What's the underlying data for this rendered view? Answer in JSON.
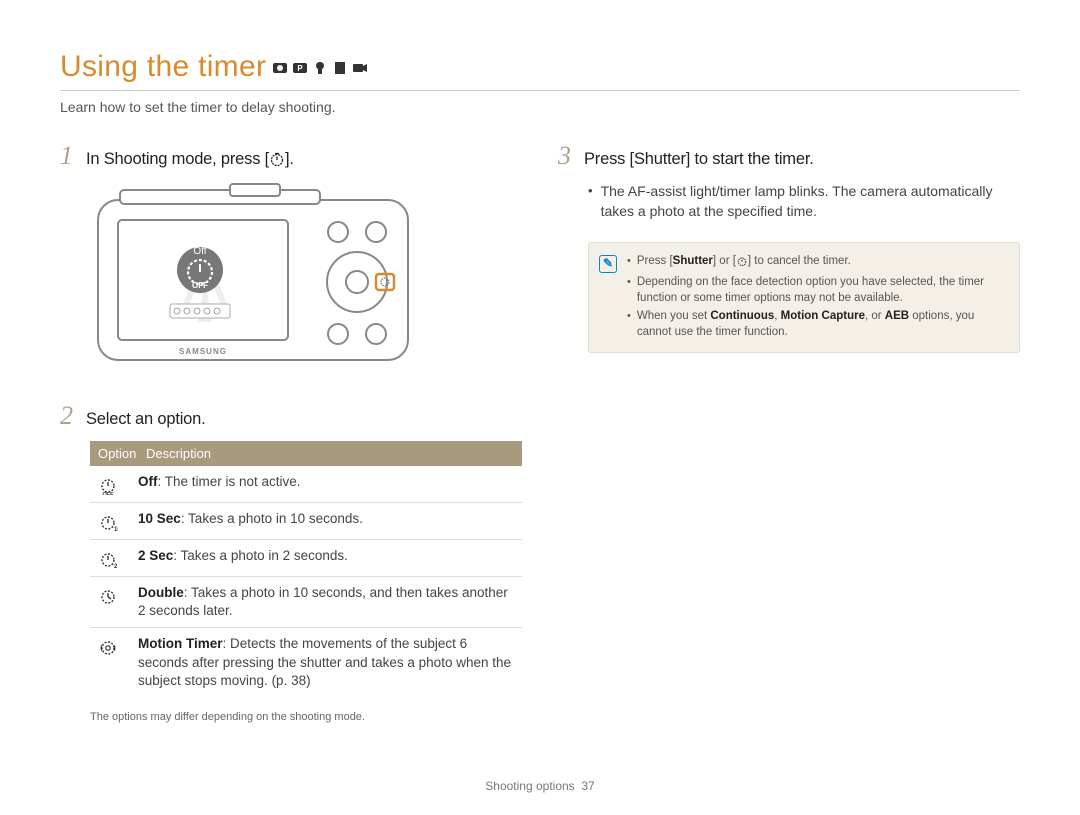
{
  "title": "Using the timer",
  "subtitle": "Learn how to set the timer to delay shooting.",
  "steps": {
    "s1": {
      "num": "1",
      "text": "In Shooting mode, press [",
      "text_after": "]."
    },
    "s2": {
      "num": "2",
      "text": "Select an option."
    },
    "s3": {
      "num": "3",
      "text": "Press [Shutter] to start the timer."
    }
  },
  "right_bullet": "The AF-assist light/timer lamp blinks. The camera automatically takes a photo at the specified time.",
  "table": {
    "head_option": "Option",
    "head_desc": "Description",
    "rows": [
      {
        "bold": "Off",
        "rest": ": The timer is not active."
      },
      {
        "bold": "10 Sec",
        "rest": ": Takes a photo in 10 seconds."
      },
      {
        "bold": "2 Sec",
        "rest": ": Takes a photo in 2 seconds."
      },
      {
        "bold": "Double",
        "rest": ": Takes a photo in 10 seconds, and then takes another 2 seconds later."
      },
      {
        "bold": "Motion Timer",
        "rest": ": Detects the movements of the subject 6 seconds after pressing the shutter and takes a photo when the subject stops moving. (p. 38)"
      }
    ],
    "footnote": "The options may differ depending on the shooting mode."
  },
  "notes": {
    "n1_pre": "Press [",
    "n1_bold": "Shutter",
    "n1_mid": "] or [",
    "n1_post": "] to cancel the timer.",
    "n2": "Depending on the face detection option you have selected, the timer function or some timer options may not be available.",
    "n3_pre": "When you set ",
    "n3_b1": "Continuous",
    "n3_sep1": ", ",
    "n3_b2": "Motion Capture",
    "n3_sep2": ", or ",
    "n3_b3": "AEB",
    "n3_post": " options, you cannot use the timer function."
  },
  "camera": {
    "screen_label": "Off",
    "brand": "SAMSUNG"
  },
  "footer": {
    "section": "Shooting options",
    "page": "37"
  }
}
